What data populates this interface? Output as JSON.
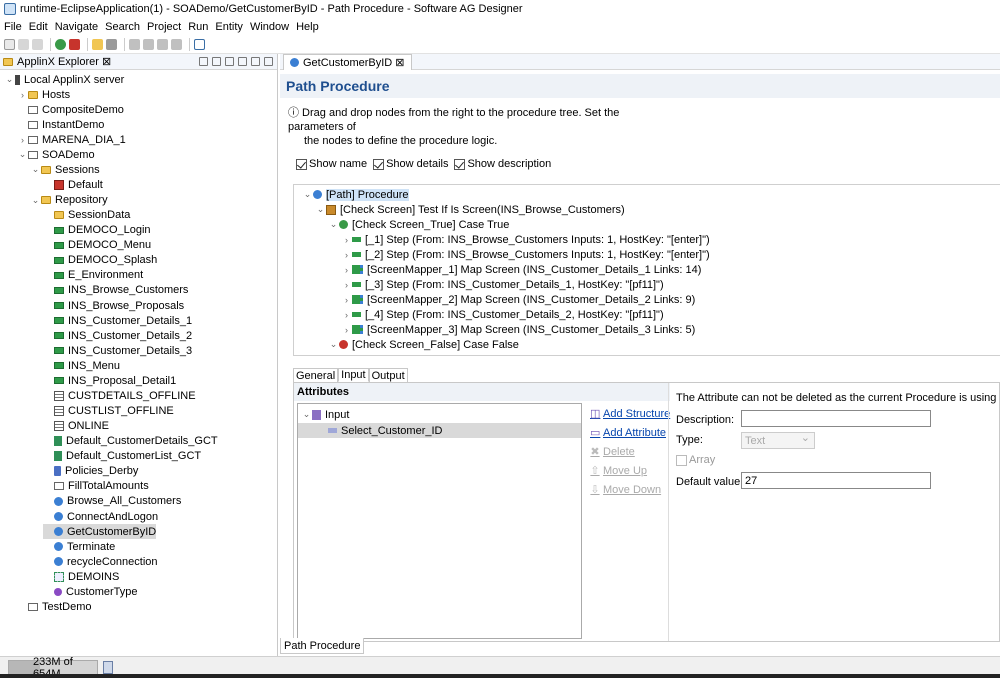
{
  "window": {
    "title": "runtime-EclipseApplication(1) - SOADemo/GetCustomerByID - Path Procedure - Software AG Designer"
  },
  "menu": [
    "File",
    "Edit",
    "Navigate",
    "Search",
    "Project",
    "Run",
    "Entity",
    "Window",
    "Help"
  ],
  "explorer": {
    "tab": "ApplinX Explorer ⊠",
    "items": [
      {
        "label": "Local ApplinX server",
        "depth": 0,
        "arrow": "⌄",
        "icon": "server"
      },
      {
        "label": "Hosts",
        "depth": 1,
        "arrow": "›",
        "icon": "folder"
      },
      {
        "label": "CompositeDemo",
        "depth": 1,
        "arrow": "",
        "icon": "app"
      },
      {
        "label": "InstantDemo",
        "depth": 1,
        "arrow": "",
        "icon": "app"
      },
      {
        "label": "MARENA_DIA_1",
        "depth": 1,
        "arrow": "›",
        "icon": "app"
      },
      {
        "label": "SOADemo",
        "depth": 1,
        "arrow": "⌄",
        "icon": "app"
      },
      {
        "label": "Sessions",
        "depth": 2,
        "arrow": "⌄",
        "icon": "folder"
      },
      {
        "label": "Default",
        "depth": 3,
        "arrow": "",
        "icon": "sess"
      },
      {
        "label": "Repository",
        "depth": 2,
        "arrow": "⌄",
        "icon": "folder"
      },
      {
        "label": "SessionData",
        "depth": 3,
        "arrow": "",
        "icon": "folder"
      },
      {
        "label": "DEMOCO_Login",
        "depth": 3,
        "arrow": "",
        "icon": "screen"
      },
      {
        "label": "DEMOCO_Menu",
        "depth": 3,
        "arrow": "",
        "icon": "screen"
      },
      {
        "label": "DEMOCO_Splash",
        "depth": 3,
        "arrow": "",
        "icon": "screen"
      },
      {
        "label": "E_Environment",
        "depth": 3,
        "arrow": "",
        "icon": "screen"
      },
      {
        "label": "INS_Browse_Customers",
        "depth": 3,
        "arrow": "",
        "icon": "screen"
      },
      {
        "label": "INS_Browse_Proposals",
        "depth": 3,
        "arrow": "",
        "icon": "screen"
      },
      {
        "label": "INS_Customer_Details_1",
        "depth": 3,
        "arrow": "",
        "icon": "screen"
      },
      {
        "label": "INS_Customer_Details_2",
        "depth": 3,
        "arrow": "",
        "icon": "screen"
      },
      {
        "label": "INS_Customer_Details_3",
        "depth": 3,
        "arrow": "",
        "icon": "screen"
      },
      {
        "label": "INS_Menu",
        "depth": 3,
        "arrow": "",
        "icon": "screen"
      },
      {
        "label": "INS_Proposal_Detail1",
        "depth": 3,
        "arrow": "",
        "icon": "screen"
      },
      {
        "label": "CUSTDETAILS_OFFLINE",
        "depth": 3,
        "arrow": "",
        "icon": "grid"
      },
      {
        "label": "CUSTLIST_OFFLINE",
        "depth": 3,
        "arrow": "",
        "icon": "grid"
      },
      {
        "label": "ONLINE",
        "depth": 3,
        "arrow": "",
        "icon": "grid"
      },
      {
        "label": "Default_CustomerDetails_GCT",
        "depth": 3,
        "arrow": "",
        "icon": "gct"
      },
      {
        "label": "Default_CustomerList_GCT",
        "depth": 3,
        "arrow": "",
        "icon": "gct"
      },
      {
        "label": "Policies_Derby",
        "depth": 3,
        "arrow": "",
        "icon": "db"
      },
      {
        "label": "FillTotalAmounts",
        "depth": 3,
        "arrow": "",
        "icon": "app"
      },
      {
        "label": "Browse_All_Customers",
        "depth": 3,
        "arrow": "",
        "icon": "proc"
      },
      {
        "label": "ConnectAndLogon",
        "depth": 3,
        "arrow": "",
        "icon": "proc"
      },
      {
        "label": "GetCustomerByID",
        "depth": 3,
        "arrow": "",
        "icon": "proc",
        "selected": true
      },
      {
        "label": "Terminate",
        "depth": 3,
        "arrow": "",
        "icon": "proc"
      },
      {
        "label": "recycleConnection",
        "depth": 3,
        "arrow": "",
        "icon": "proc"
      },
      {
        "label": "DEMOINS",
        "depth": 3,
        "arrow": "",
        "icon": "conn"
      },
      {
        "label": "CustomerType",
        "depth": 3,
        "arrow": "",
        "icon": "purple"
      },
      {
        "label": "TestDemo",
        "depth": 1,
        "arrow": "",
        "icon": "app"
      }
    ]
  },
  "editor": {
    "tab": "GetCustomerByID ⊠",
    "title": "Path Procedure",
    "info_line1": "ⓘ Drag and drop nodes from the right to the procedure tree. Set the parameters of",
    "info_line2": "the nodes to define the procedure logic.",
    "checks": [
      {
        "label": "Show name",
        "checked": true
      },
      {
        "label": "Show details",
        "checked": true
      },
      {
        "label": "Show description",
        "checked": true
      }
    ],
    "tree": [
      {
        "label": "[Path] Procedure",
        "depth": 0,
        "arrow": "⌄",
        "icon": "proc",
        "selected": true
      },
      {
        "label": "[Check Screen] Test If Is Screen(INS_Browse_Customers)",
        "depth": 1,
        "arrow": "⌄",
        "icon": "check"
      },
      {
        "label": "[Check Screen_True] Case True",
        "depth": 2,
        "arrow": "⌄",
        "icon": "true"
      },
      {
        "label": "[_1] Step (From: INS_Browse_Customers Inputs: 1, HostKey: \"[enter]\")",
        "depth": 3,
        "arrow": "›",
        "icon": "step"
      },
      {
        "label": "[_2] Step (From: INS_Browse_Customers Inputs: 1, HostKey: \"[enter]\")",
        "depth": 3,
        "arrow": "›",
        "icon": "step"
      },
      {
        "label": "[ScreenMapper_1] Map Screen (INS_Customer_Details_1 Links: 14)",
        "depth": 3,
        "arrow": "›",
        "icon": "map"
      },
      {
        "label": "[_3] Step (From: INS_Customer_Details_1, HostKey: \"[pf11]\")",
        "depth": 3,
        "arrow": "›",
        "icon": "step"
      },
      {
        "label": "[ScreenMapper_2] Map Screen (INS_Customer_Details_2 Links: 9)",
        "depth": 3,
        "arrow": "›",
        "icon": "map"
      },
      {
        "label": "[_4] Step (From: INS_Customer_Details_2, HostKey: \"[pf11]\")",
        "depth": 3,
        "arrow": "›",
        "icon": "step"
      },
      {
        "label": "[ScreenMapper_3] Map Screen (INS_Customer_Details_3 Links: 5)",
        "depth": 3,
        "arrow": "›",
        "icon": "map"
      },
      {
        "label": "[Check Screen_False] Case False",
        "depth": 2,
        "arrow": "⌄",
        "icon": "false"
      }
    ],
    "subtabs": [
      "General",
      "Input",
      "Output"
    ],
    "attributes": {
      "header": "Attributes",
      "tree": [
        {
          "label": "Input",
          "depth": 0,
          "arrow": "⌄"
        },
        {
          "label": "Select_Customer_ID",
          "depth": 1,
          "arrow": "",
          "selected": true
        }
      ],
      "buttons": [
        {
          "label": "Add Structure",
          "enabled": true,
          "icon": "◫"
        },
        {
          "label": "Add Attribute",
          "enabled": true,
          "icon": "▭"
        },
        {
          "label": "Delete",
          "enabled": false,
          "icon": "✖"
        },
        {
          "label": "Move Up",
          "enabled": false,
          "icon": "⇧"
        },
        {
          "label": "Move Down",
          "enabled": false,
          "icon": "⇩"
        }
      ],
      "note": "The Attribute can not be deleted as the current Procedure is using it.",
      "description_label": "Description:",
      "description_value": "",
      "type_label": "Type:",
      "type_value": "Text",
      "array_label": "Array",
      "default_label": "Default value:",
      "default_value": "27"
    },
    "bottom_tab": "Path Procedure"
  },
  "status": {
    "memory": "233M of 654M",
    "memory_used_fraction": 0.356
  }
}
